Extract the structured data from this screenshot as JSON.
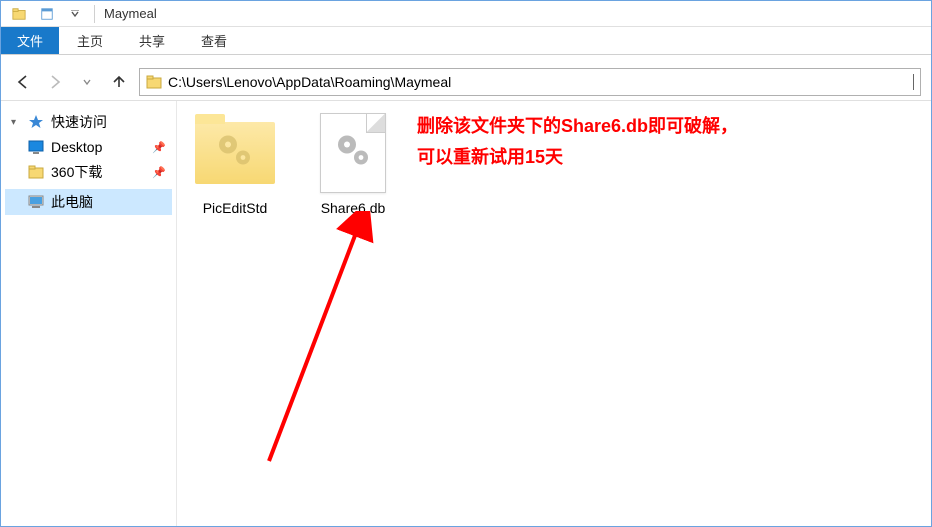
{
  "titlebar": {
    "title": "Maymeal"
  },
  "ribbon": {
    "file_tab": "文件",
    "tabs": [
      "主页",
      "共享",
      "查看"
    ]
  },
  "address": {
    "path": "C:\\Users\\Lenovo\\AppData\\Roaming\\Maymeal"
  },
  "sidebar": {
    "quick_access": "快速访问",
    "items": [
      {
        "label": "Desktop",
        "pinned": true
      },
      {
        "label": "360下载",
        "pinned": true
      }
    ],
    "this_pc": "此电脑"
  },
  "files": [
    {
      "name": "PicEditStd",
      "type": "folder"
    },
    {
      "name": "Share6.db",
      "type": "file"
    }
  ],
  "annotation": {
    "line1": "删除该文件夹下的Share6.db即可破解，",
    "line2": "可以重新试用15天"
  }
}
